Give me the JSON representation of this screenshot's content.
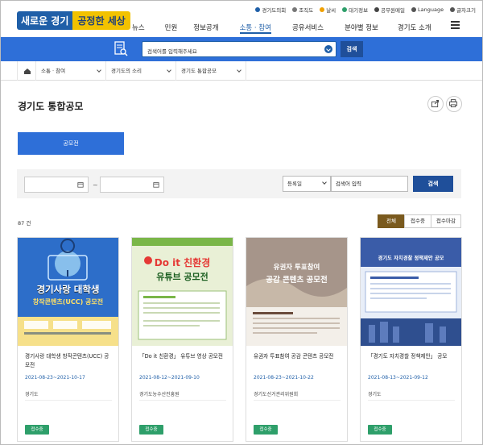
{
  "utility": {
    "items": [
      "경기도의회",
      "조직도",
      "날씨",
      "대기정보",
      "공무원메일",
      "Language",
      "글자크기"
    ],
    "colors": [
      "#1f5fa8",
      "#777",
      "#f0a000",
      "#2e9f6a",
      "#444",
      "#555",
      "#555"
    ]
  },
  "logo": {
    "part1": "새로운 경기",
    "part2": "공정한 세상"
  },
  "gnb": {
    "items": [
      "뉴스",
      "민원",
      "정보공개",
      "소통 · 참여",
      "공유서비스",
      "분야별 정보",
      "경기도 소개"
    ],
    "active_index": 3
  },
  "search": {
    "placeholder": "검색어를 입력해주세요",
    "button": "검색"
  },
  "breadcrumb": {
    "items": [
      "소통 · 참여",
      "경기도의 소리",
      "경기도 통합공모"
    ]
  },
  "page": {
    "title": "경기도 통합공모"
  },
  "category_tab": {
    "label": "공모전"
  },
  "filter": {
    "separator": "~",
    "sort_select": "등록일",
    "keyword_value": "검색어 입력",
    "search_button": "검색"
  },
  "results": {
    "count": "87 건"
  },
  "status_tabs": [
    {
      "label": "전체",
      "active": true
    },
    {
      "label": "접수중",
      "active": false
    },
    {
      "label": "접수마감",
      "active": false
    }
  ],
  "cards": [
    {
      "title": "경기사랑 대학생 창작콘텐츠(UCC) 공모전",
      "period": "2021-08-23~2021-10-17",
      "org": "경기도",
      "status": "접수중",
      "poster": {
        "line1": "경기사랑 대학생",
        "line2": "창작콘텐츠(UCC) 공모전",
        "bg": "#2d6ec9"
      }
    },
    {
      "title": "「Do it 친환경」 유튜브 영상 공모전",
      "period": "2021-08-12~2021-09-10",
      "org": "경기도농수산진흥원",
      "status": "접수중",
      "poster": {
        "line1": "Do it 친환경",
        "line2": "유튜브 공모전",
        "bg": "#e9f0d6"
      }
    },
    {
      "title": "유권자 투표참여 공감 콘텐츠 공모전",
      "period": "2021-08-23~2021-10-22",
      "org": "경기도선거관리위원회",
      "status": "접수중",
      "poster": {
        "line1": "유권자 투표참여",
        "line2": "공감 콘텐츠 공모전",
        "bg": "#c7b8a8"
      }
    },
    {
      "title": "「경기도 자치경찰 정책제안」 공모",
      "period": "2021-08-13~2021-09-12",
      "org": "경기도",
      "status": "접수중",
      "poster": {
        "line1": "경기도 자치경찰 정책제안 공모",
        "line2": "",
        "bg": "#3a5ca8"
      }
    }
  ]
}
